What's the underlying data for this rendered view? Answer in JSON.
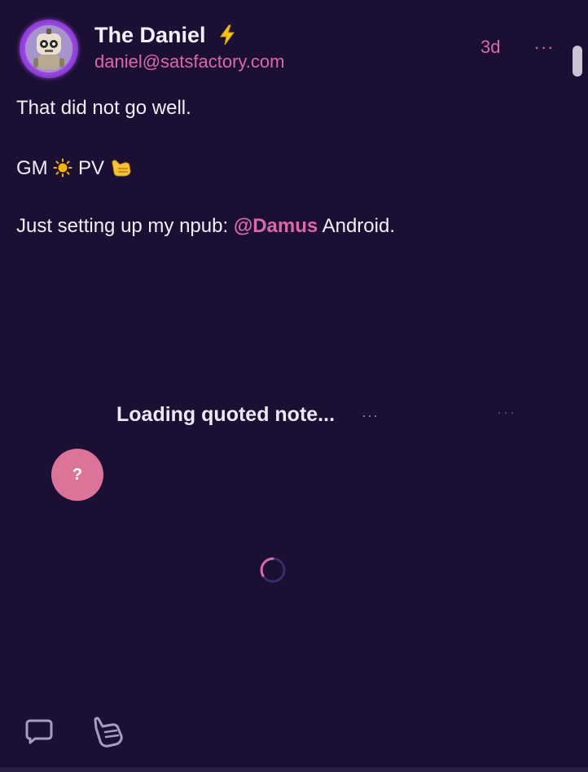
{
  "post": {
    "author": {
      "display_name": "The Daniel",
      "nip05": "daniel@satsfactory.com",
      "avatar": "robot-avatar",
      "badge_icon": "lightning-bolt-icon"
    },
    "timestamp": "3d",
    "more_icon": "ellipsis-icon",
    "more_label": "···",
    "content": {
      "line1": "That did not go well.",
      "line2_prefix": "GM ",
      "line2_sun": "sun-emoji",
      "line2_mid": " PV ",
      "line2_hand": "call-me-hand-emoji",
      "line3_prefix": "Just setting up my npub: ",
      "line3_mention": "@Damus",
      "line3_suffix": " Android."
    },
    "quoted_note": {
      "label": "Loading quoted note...",
      "dots_primary": "···",
      "dots_secondary": "···",
      "avatar_placeholder": "?"
    },
    "actions": {
      "reply_icon": "chat-bubble-icon",
      "like_icon": "shaka-hand-icon"
    }
  },
  "colors": {
    "background": "#1b0f33",
    "accent": "#d96aa8",
    "text": "#f2eef8",
    "placeholder_avatar": "#dc7399"
  }
}
